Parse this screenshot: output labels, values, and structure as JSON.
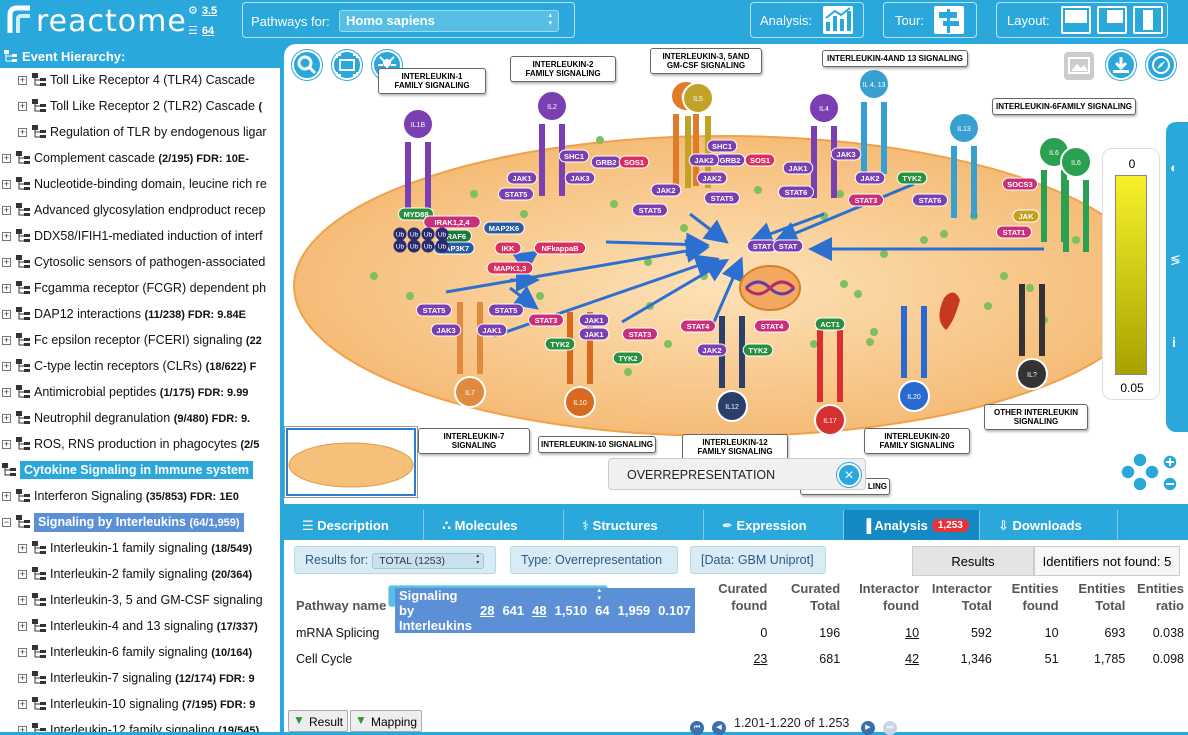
{
  "header": {
    "logo_text": "reactome",
    "version_a": "3.5",
    "version_b": "64",
    "species_label": "Pathways for:",
    "species_value": "Homo sapiens",
    "analysis_label": "Analysis:",
    "tour_label": "Tour:",
    "layout_label": "Layout:"
  },
  "hierarchy": {
    "title": "Event Hierarchy:",
    "items": [
      {
        "label": "Toll Like Receptor 4 (TLR4) Cascade",
        "stats": "",
        "level": 1
      },
      {
        "label": "Toll Like Receptor 2 (TLR2) Cascade",
        "stats": "(",
        "level": 1
      },
      {
        "label": "Regulation of TLR by endogenous ligar",
        "stats": "",
        "level": 1
      },
      {
        "label": "Complement cascade",
        "stats": "(2/195) FDR: 10E-",
        "level": 0
      },
      {
        "label": "Nucleotide-binding domain, leucine rich re",
        "stats": "",
        "level": 0
      },
      {
        "label": "Advanced glycosylation endproduct recep",
        "stats": "",
        "level": 0
      },
      {
        "label": "DDX58/IFIH1-mediated induction of interf",
        "stats": "",
        "level": 0
      },
      {
        "label": "Cytosolic sensors of pathogen-associated",
        "stats": "",
        "level": 0
      },
      {
        "label": "Fcgamma receptor (FCGR) dependent ph",
        "stats": "",
        "level": 0
      },
      {
        "label": "DAP12 interactions",
        "stats": "(11/238) FDR: 9.84E",
        "level": 0
      },
      {
        "label": "Fc epsilon receptor (FCERI) signaling",
        "stats": "(22",
        "level": 0
      },
      {
        "label": "C-type lectin receptors (CLRs)",
        "stats": "(18/622) F",
        "level": 0
      },
      {
        "label": "Antimicrobial peptides",
        "stats": "(1/175) FDR: 9.99",
        "level": 0
      },
      {
        "label": "Neutrophil degranulation",
        "stats": "(9/480) FDR: 9.",
        "level": 0
      },
      {
        "label": "ROS, RNS production in phagocytes",
        "stats": "(2/5",
        "level": 0
      },
      {
        "label": "Cytokine Signaling in Immune system",
        "stats": "",
        "level": -1
      },
      {
        "label": "Interferon Signaling",
        "stats": "(35/853) FDR: 1E0",
        "level": 0
      },
      {
        "label": "Signaling by Interleukins",
        "stats": "(64/1,959)",
        "level": 0
      },
      {
        "label": "Interleukin-1 family signaling",
        "stats": "(18/549)",
        "level": 1
      },
      {
        "label": "Interleukin-2 family signaling",
        "stats": "(20/364)",
        "level": 1
      },
      {
        "label": "Interleukin-3, 5 and GM-CSF signaling",
        "stats": "",
        "level": 1
      },
      {
        "label": "Interleukin-4 and 13 signaling",
        "stats": "(17/337)",
        "level": 1
      },
      {
        "label": "Interleukin-6 family signaling",
        "stats": "(10/164)",
        "level": 1
      },
      {
        "label": "Interleukin-7 signaling",
        "stats": "(12/174) FDR: 9",
        "level": 1
      },
      {
        "label": "Interleukin-10 signaling",
        "stats": "(7/195) FDR: 9",
        "level": 1
      },
      {
        "label": "Interleukin-12 family signaling",
        "stats": "(19/545)",
        "level": 1
      }
    ]
  },
  "diagram": {
    "labels": {
      "il1": "INTERLEUKIN-1\nFAMILY SIGNALING",
      "il2": "INTERLEUKIN-2\nFAMILY SIGNALING",
      "il3": "INTERLEUKIN-3, 5AND\nGM-CSF SIGNALING",
      "il4": "INTERLEUKIN-4AND 13 SIGNALING",
      "il6": "INTERLEUKIN-6FAMILY SIGNALING",
      "il7": "INTERLEUKIN-7 SIGNALING",
      "il10": "INTERLEUKIN-10 SIGNALING",
      "il12": "INTERLEUKIN-12\nFAMILY SIGNALING",
      "il20": "INTERLEUKIN-20\nFAMILY SIGNALING",
      "other": "OTHER INTERLEUKIN\nSIGNALING",
      "il17": "LING"
    },
    "receptors": [
      "IL1B",
      "IL2",
      "IL3",
      "IL5",
      "IL4",
      "IL\n4, 13",
      "IL13",
      "IL6",
      "IL6",
      "IL7",
      "IL10",
      "IL12",
      "IL17",
      "IL20",
      "IL?"
    ],
    "nodes": [
      "MYD88",
      "IRAK1,2,4",
      "TRAF6",
      "MAP3K7",
      "MAP2K6",
      "IKK",
      "NFkappaB",
      "MAPK1,3",
      "SHC1",
      "GRB2",
      "SOS1",
      "JAK1",
      "JAK3",
      "STAT5",
      "SHC1",
      "GRB2",
      "SOS1",
      "JAK2",
      "JAK2",
      "STAT5",
      "STAT5",
      "JAK2",
      "JAK1",
      "JAK3",
      "STAT6",
      "JAK2",
      "TYK2",
      "STAT3",
      "STAT6",
      "SOCS3",
      "JAK",
      "STAT1",
      "STAT",
      "STAT",
      "STAT5",
      "STAT5",
      "JAK3",
      "JAK1",
      "STAT3",
      "JAK1",
      "JAK1",
      "STAT3",
      "TYK2",
      "TYK2",
      "STAT4",
      "STAT4",
      "JAK2",
      "TYK2",
      "ACT1"
    ],
    "ub": [
      "Ub",
      "Ub",
      "Ub",
      "Ub",
      "Ub",
      "Ub",
      "Ub",
      "Ub"
    ],
    "legend_top": "0",
    "legend_bottom": "0.05",
    "overlay_label": "OVERREPRESENTATION",
    "overlay_close": "×"
  },
  "tabs": [
    {
      "label": "Description",
      "icon": "description-icon"
    },
    {
      "label": "Molecules",
      "icon": "molecules-icon"
    },
    {
      "label": "Structures",
      "icon": "structures-icon"
    },
    {
      "label": "Expression",
      "icon": "expression-icon"
    },
    {
      "label": "Analysis",
      "icon": "analysis-icon",
      "badge": "1,253"
    },
    {
      "label": "Downloads",
      "icon": "downloads-icon"
    }
  ],
  "analysis": {
    "results_for_label": "Results for:",
    "results_for_value": "TOTAL (1253)",
    "type_label": "Type: Overrepresentation",
    "data_label": "[Data: GBM Uniprot]",
    "results_tab": "Results",
    "not_found_tab": "Identifiers not found: 5",
    "columns": [
      "Pathway name",
      "Curated\nfound",
      "Curated\nTotal",
      "Interactor\nfound",
      "Interactor\nTotal",
      "Entities\nfound",
      "Entities\nTotal",
      "Entities\nratio"
    ],
    "rows": [
      {
        "name": "mRNA Splicing",
        "c_found": "0",
        "c_total": "196",
        "i_found": "10",
        "i_total": "592",
        "e_found": "10",
        "e_total": "693",
        "e_ratio": "0.038"
      },
      {
        "name": "Signaling by Interleukins",
        "c_found": "28",
        "c_total": "641",
        "i_found": "48",
        "i_total": "1,510",
        "e_found": "64",
        "e_total": "1,959",
        "e_ratio": "0.107"
      },
      {
        "name": "Cell Cycle",
        "c_found": "23",
        "c_total": "681",
        "i_found": "42",
        "i_total": "1,346",
        "e_found": "51",
        "e_total": "1,785",
        "e_ratio": "0.098"
      }
    ],
    "result_button": "Result",
    "mapping_button": "Mapping",
    "pager_text": "1.201-1.220 of 1.253"
  },
  "colors": {
    "brand": "#2aa8dc",
    "selected_row": "#5b8fd6",
    "badge": "#e8323a",
    "cytoplasm": "#f8c88c"
  }
}
